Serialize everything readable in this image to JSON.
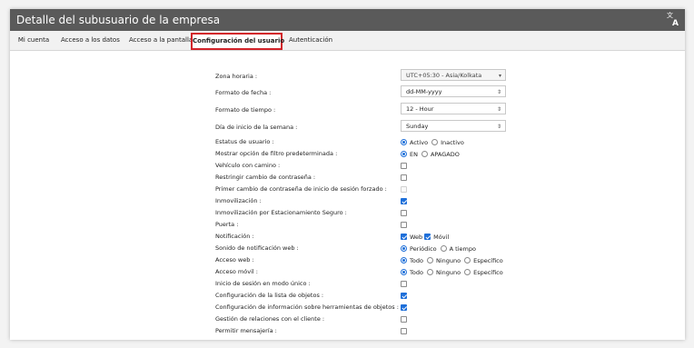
{
  "header": {
    "title": "Detalle del subusuario de la empresa",
    "icon": "translate-icon"
  },
  "tabs": [
    {
      "label": "Mi cuenta",
      "active": false
    },
    {
      "label": "Acceso a los datos",
      "active": false
    },
    {
      "label": "Acceso a la pantalla",
      "active": false
    },
    {
      "label": "Configuración del usuario",
      "active": true
    },
    {
      "label": "Autenticación",
      "active": false
    }
  ],
  "settings": {
    "timezone": {
      "label": "Zona horaria :",
      "value": "UTC+05:30 - Asia/Kolkata"
    },
    "date_format": {
      "label": "Formato de fecha :",
      "value": "dd-MM-yyyy"
    },
    "time_format": {
      "label": "Formato de tiempo :",
      "value": "12 - Hour"
    },
    "week_start": {
      "label": "Día de inicio de la semana :",
      "value": "Sunday"
    },
    "user_status": {
      "label": "Estatus de usuario :",
      "options": [
        "Activo",
        "Inactivo"
      ],
      "selected": "Activo"
    },
    "default_filter": {
      "label": "Mostrar opción de filtro predeterminada :",
      "options": [
        "EN",
        "APAGADO"
      ],
      "selected": "EN"
    },
    "vehicle_route": {
      "label": "Vehículo con camino :",
      "checked": false
    },
    "restrict_password": {
      "label": "Restringir cambio de contraseña :",
      "checked": false
    },
    "forced_first_change": {
      "label": "Primer cambio de contraseña de inicio de sesión forzado :",
      "checked": false,
      "disabled": true
    },
    "immobilization": {
      "label": "Inmovilización :",
      "checked": true
    },
    "immobilization_parking": {
      "label": "Inmovilización por Estacionamiento Seguro :",
      "checked": false
    },
    "door": {
      "label": "Puerta :",
      "checked": false
    },
    "notification": {
      "label": "Notificación :",
      "options": [
        "Web",
        "Móvil"
      ],
      "checked": [
        true,
        true
      ]
    },
    "web_notification_sound": {
      "label": "Sonido de notificación web :",
      "options": [
        "Periódico",
        "A tiempo"
      ],
      "selected": "Periódico"
    },
    "web_access": {
      "label": "Acceso web :",
      "options": [
        "Todo",
        "Ninguno",
        "Específico"
      ],
      "selected": "Todo"
    },
    "mobile_access": {
      "label": "Acceso móvil :",
      "options": [
        "Todo",
        "Ninguno",
        "Específico"
      ],
      "selected": "Todo"
    },
    "single_session": {
      "label": "Inicio de sesión en modo único :",
      "checked": false
    },
    "object_list_config": {
      "label": "Configuración de la lista de objetos :",
      "checked": true
    },
    "tools_info_config": {
      "label": "Configuración de información sobre herramientas de objetos :",
      "checked": true
    },
    "crm": {
      "label": "Gestión de relaciones con el cliente :",
      "checked": false
    },
    "messaging": {
      "label": "Permitir mensajería :",
      "checked": false
    }
  },
  "colors": {
    "titlebar": "#5a5a5a",
    "active_tab_border": "#d2232a",
    "accent": "#1e6fd9"
  }
}
